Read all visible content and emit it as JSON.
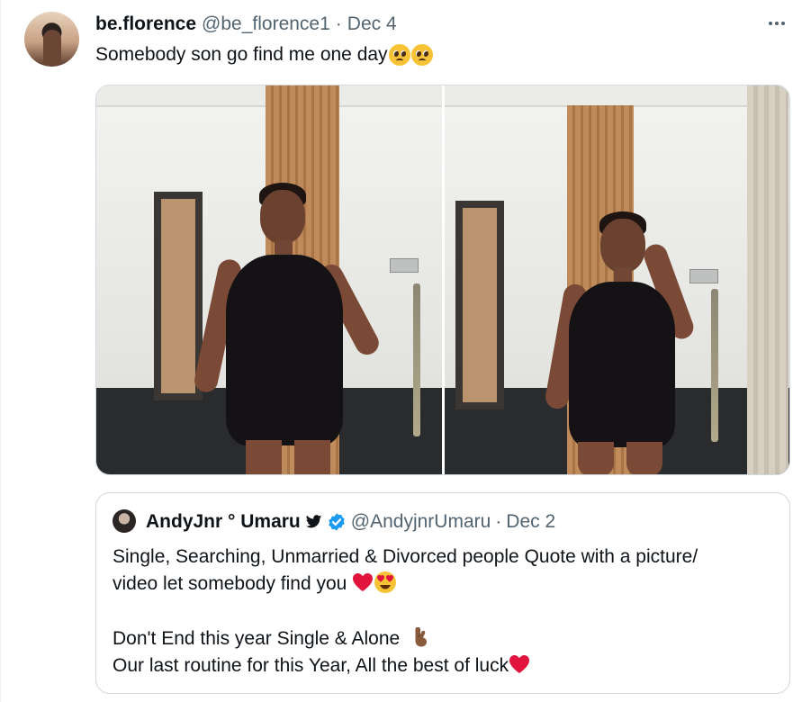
{
  "tweet": {
    "display_name": "be.florence",
    "handle": "@be_florence1",
    "separator": "·",
    "date": "Dec 4",
    "text": "Somebody son go find me one day",
    "text_emoji": [
      "pleading-face",
      "pleading-face"
    ],
    "more_icon": "more-horizontal-icon",
    "media_count": 2
  },
  "quoted": {
    "display_name": "AndyJnr ° Umaru",
    "handle": "@AndyjnrUmaru",
    "separator": "·",
    "date": "Dec 2",
    "badges": [
      "twitter-bird-icon",
      "verified-badge-icon"
    ],
    "line1": "Single, Searching, Unmarried & Divorced people Quote with a picture/",
    "line2": "video let somebody find you",
    "line2_emoji": [
      "red-heart",
      "heart-eyes-face"
    ],
    "line3": "Don't End this year Single & Alone",
    "line3_emoji": [
      "pinching-hand"
    ],
    "line4": "Our last routine for this Year, All the best of luck",
    "line4_emoji": [
      "red-heart"
    ]
  },
  "colors": {
    "text": "#0f1419",
    "secondary": "#536471",
    "border": "#cfd9de",
    "verified": "#1d9bf0",
    "heart": "#e0143c"
  }
}
